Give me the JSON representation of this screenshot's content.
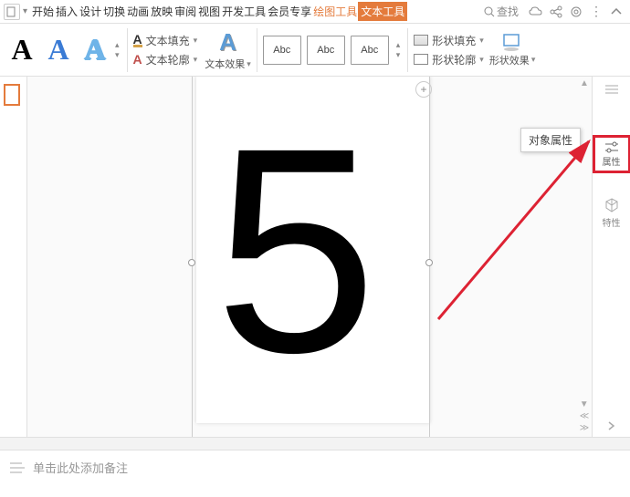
{
  "menu": {
    "tabs": [
      "开始",
      "插入",
      "设计",
      "切换",
      "动画",
      "放映",
      "审阅",
      "视图",
      "开发工具",
      "会员专享"
    ],
    "tab_draw": "绘图工具",
    "tab_text": "文本工具",
    "search": "查找"
  },
  "ribbon": {
    "textfill": "文本填充",
    "textoutline": "文本轮廓",
    "textfx": "文本效果",
    "abc": "Abc",
    "shapefill": "形状填充",
    "shapeoutline": "形状轮廓",
    "shapefx": "形状效果"
  },
  "tooltip": "对象属性",
  "rightpanel": {
    "prop": "属性",
    "trait": "特性"
  },
  "slide": {
    "content": "5"
  },
  "notes": {
    "placeholder": "单击此处添加备注"
  }
}
